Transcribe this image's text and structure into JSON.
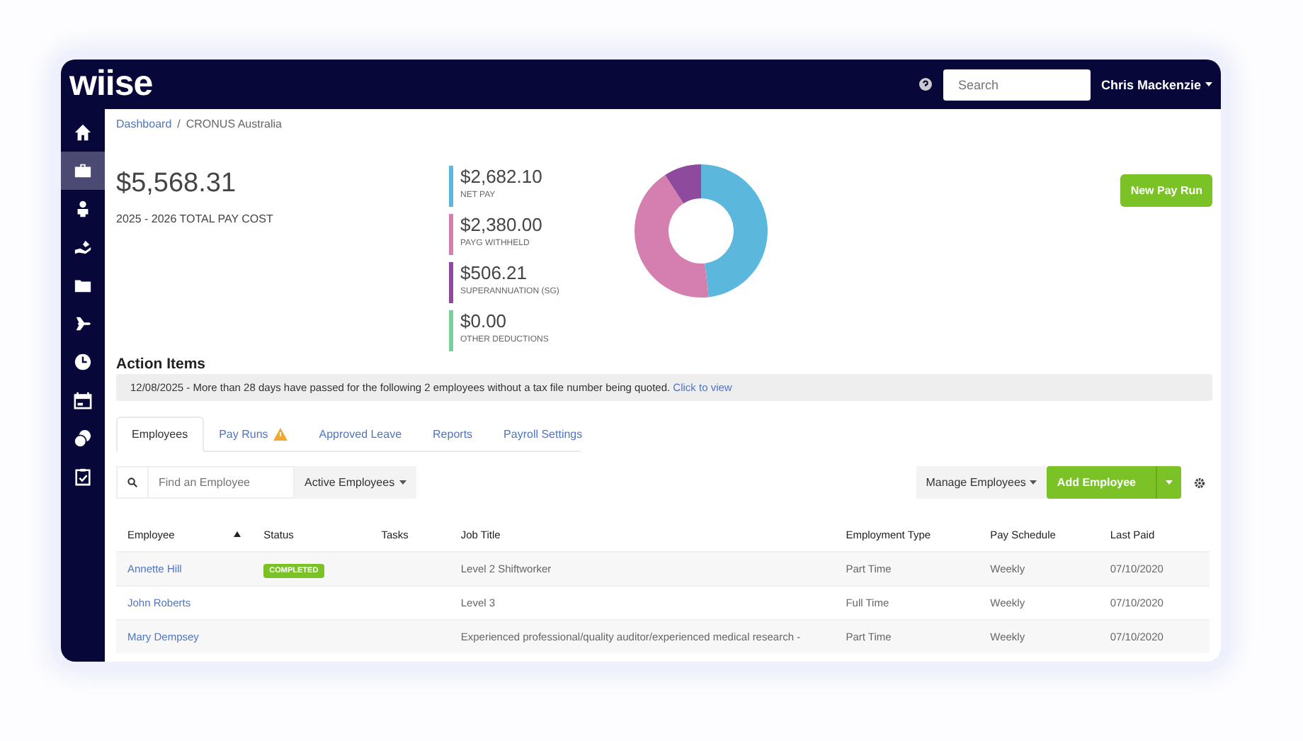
{
  "header": {
    "logo": "wiise",
    "search": {
      "placeholder": "Search"
    },
    "user": "Chris Mackenzie"
  },
  "sidebar": {
    "items": [
      {
        "selected": false
      },
      {
        "selected": true
      },
      {
        "selected": false
      },
      {
        "selected": false
      },
      {
        "selected": false
      },
      {
        "selected": false
      },
      {
        "selected": false
      },
      {
        "selected": false
      },
      {
        "selected": false
      },
      {
        "selected": false
      }
    ]
  },
  "breadcrumb": {
    "separator": "/",
    "items": [
      {
        "label": "Dashboard",
        "kind": "link"
      },
      {
        "label": "CRONUS Australia",
        "kind": "current"
      }
    ]
  },
  "total": {
    "amount": "$5,568.31",
    "label": "2025 - 2026 TOTAL PAY COST"
  },
  "breakdown": [
    {
      "amount": "$2,682.10"
    },
    {
      "amount": "$2,380.00"
    },
    {
      "amount": "$506.21"
    },
    {
      "amount": "$0.00"
    }
  ],
  "chart_data": {
    "type": "donut",
    "categories": [
      "NET PAY",
      "PAYG WITHHELD",
      "SUPERANNUATION (SG)",
      "OTHER DEDUCTIONS"
    ],
    "values": [
      48.17,
      42.74,
      9.09,
      0
    ],
    "colors": [
      "#5bb8dc",
      "#d47faf",
      "#8e4a9c",
      "#7ccf9c"
    ]
  },
  "new_pay_run_button": "New Pay Run",
  "action_items": {
    "title": "Action Items",
    "items": [
      {
        "text": "12/08/2025 - More than 28 days have passed for the following 2 employees without a tax file number being quoted.",
        "link": "Click to view"
      }
    ]
  },
  "tabs": [
    {
      "label": "Employees",
      "selected": true,
      "warning": false
    },
    {
      "label": "Pay Runs",
      "selected": false,
      "warning": true
    },
    {
      "label": "Approved Leave",
      "selected": false,
      "warning": false
    },
    {
      "label": "Reports",
      "selected": false,
      "warning": false
    },
    {
      "label": "Payroll Settings",
      "selected": false,
      "warning": false
    }
  ],
  "toolbar": {
    "search": {
      "placeholder": "Find an Employee"
    },
    "filter": "Active Employees",
    "manage_button": "Manage Employees",
    "add_button": "Add Employee"
  },
  "table": {
    "columns": [
      {
        "label": "Employee",
        "sorted": true
      },
      {
        "label": "Status",
        "sorted": false
      },
      {
        "label": "Tasks",
        "sorted": false
      },
      {
        "label": "Job Title",
        "sorted": false
      },
      {
        "label": "Employment Type",
        "sorted": false
      },
      {
        "label": "Pay Schedule",
        "sorted": false
      },
      {
        "label": "Last Paid",
        "sorted": false
      }
    ],
    "rows": [
      {
        "employee": "Annette Hill",
        "status": "COMPLETED",
        "job_title": "Level 2 Shiftworker",
        "employment_type": "Part Time",
        "pay_schedule": "Weekly",
        "last_paid": "07/10/2020"
      },
      {
        "employee": "John Roberts",
        "job_title": "Level 3",
        "employment_type": "Full Time",
        "pay_schedule": "Weekly",
        "last_paid": "07/10/2020"
      },
      {
        "employee": "Mary Dempsey",
        "job_title": "Experienced professional/quality auditor/experienced medical research -",
        "employment_type": "Part Time",
        "pay_schedule": "Weekly",
        "last_paid": "07/10/2020"
      }
    ]
  }
}
